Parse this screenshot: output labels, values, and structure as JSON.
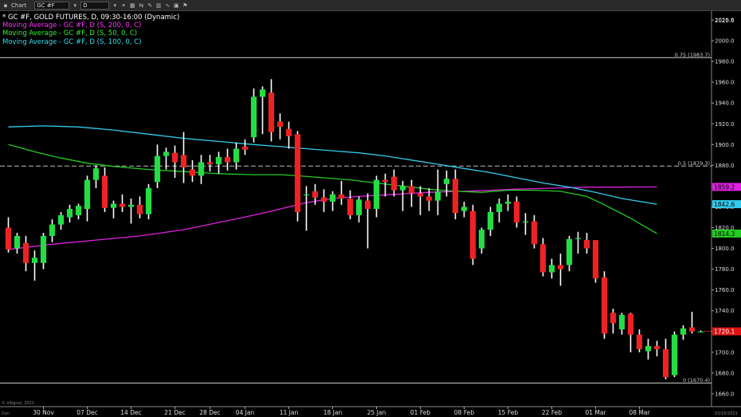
{
  "toolbar": {
    "window_label": "Chart",
    "symbol": "GC #F",
    "interval": "D"
  },
  "legend": {
    "main": "* GC #F, GOLD FUTURES, D, 09:30-16:00 (Dynamic)",
    "ma200": "Moving Average - GC #F, D (S, 200, 0, C)",
    "ma50": "Moving Average - GC #F, D (S, 50, 0, C)",
    "ma100": "Moving Average - GC #F, D (S, 100, 0, C)"
  },
  "colors": {
    "up": "#22dd44",
    "down": "#ee2222",
    "ma200": "#e020e0",
    "ma50": "#22cc22",
    "ma100": "#33ccee",
    "text_main": "#ffffff",
    "text_ma200": "#ff33ff",
    "text_ma50": "#33ee33",
    "text_ma100": "#33ddee"
  },
  "footer": {
    "copyright": "© eSignal, 2021",
    "dyn": "Dyn",
    "date": "03/16/2021"
  },
  "chart_data": {
    "type": "candlestick",
    "title": "* GC #F, GOLD FUTURES, D, 09:30-16:00 (Dynamic)",
    "y_axis_ticks": [
      1660,
      1680,
      1700,
      1720,
      1740,
      1760,
      1780,
      1800,
      1820,
      1840,
      1860,
      1880,
      1900,
      1920,
      1940,
      1960,
      1980,
      2000,
      2020
    ],
    "y_top_label": "2025.6",
    "ylim": [
      1656,
      2025.6
    ],
    "x_axis_labels": [
      {
        "index": 4,
        "label": "30 Nov"
      },
      {
        "index": 9,
        "label": "07 Dec"
      },
      {
        "index": 14,
        "label": "14 Dec"
      },
      {
        "index": 19,
        "label": "21 Dec"
      },
      {
        "index": 23,
        "label": "28 Dec"
      },
      {
        "index": 27,
        "label": "04 Jan"
      },
      {
        "index": 32,
        "label": "11 Jan"
      },
      {
        "index": 37,
        "label": "18 Jan"
      },
      {
        "index": 42,
        "label": "25 Jan"
      },
      {
        "index": 47,
        "label": "01 Feb"
      },
      {
        "index": 52,
        "label": "08 Feb"
      },
      {
        "index": 57,
        "label": "15 Feb"
      },
      {
        "index": 62,
        "label": "22 Feb"
      },
      {
        "index": 67,
        "label": "01 Mar"
      },
      {
        "index": 72,
        "label": "08 Mar"
      }
    ],
    "fib_levels": [
      {
        "ratio_label": "0.75 (1983.7)",
        "value": 1983.7
      },
      {
        "ratio_label": "0.5 (1879.3)",
        "value": 1879.3
      },
      {
        "ratio_label": "0 (1670.4)",
        "value": 1670.4
      }
    ],
    "ma_badges": [
      {
        "label": "1859.2",
        "value": 1859.2,
        "series": "ma200"
      },
      {
        "label": "1842.6",
        "value": 1842.6,
        "series": "ma100"
      },
      {
        "label": "1814.3",
        "value": 1814.3,
        "series": "ma50"
      }
    ],
    "last_price": {
      "label": "1720.1",
      "value": 1720.1
    },
    "candles": [
      {
        "o": 1820,
        "h": 1830,
        "l": 1796,
        "c": 1799
      },
      {
        "o": 1800,
        "h": 1815,
        "l": 1795,
        "c": 1812
      },
      {
        "o": 1805,
        "h": 1812,
        "l": 1778,
        "c": 1786
      },
      {
        "o": 1786,
        "h": 1798,
        "l": 1769,
        "c": 1791
      },
      {
        "o": 1786,
        "h": 1815,
        "l": 1780,
        "c": 1812
      },
      {
        "o": 1812,
        "h": 1828,
        "l": 1806,
        "c": 1823
      },
      {
        "o": 1823,
        "h": 1835,
        "l": 1818,
        "c": 1832
      },
      {
        "o": 1830,
        "h": 1842,
        "l": 1825,
        "c": 1838
      },
      {
        "o": 1832,
        "h": 1843,
        "l": 1828,
        "c": 1841
      },
      {
        "o": 1838,
        "h": 1870,
        "l": 1826,
        "c": 1866
      },
      {
        "o": 1866,
        "h": 1880,
        "l": 1858,
        "c": 1877
      },
      {
        "o": 1870,
        "h": 1878,
        "l": 1835,
        "c": 1839
      },
      {
        "o": 1839,
        "h": 1846,
        "l": 1829,
        "c": 1843
      },
      {
        "o": 1843,
        "h": 1852,
        "l": 1835,
        "c": 1840
      },
      {
        "o": 1840,
        "h": 1848,
        "l": 1824,
        "c": 1842
      },
      {
        "o": 1842,
        "h": 1850,
        "l": 1829,
        "c": 1833
      },
      {
        "o": 1833,
        "h": 1862,
        "l": 1828,
        "c": 1858
      },
      {
        "o": 1864,
        "h": 1900,
        "l": 1858,
        "c": 1889
      },
      {
        "o": 1889,
        "h": 1897,
        "l": 1876,
        "c": 1893
      },
      {
        "o": 1892,
        "h": 1899,
        "l": 1868,
        "c": 1883
      },
      {
        "o": 1890,
        "h": 1912,
        "l": 1863,
        "c": 1878
      },
      {
        "o": 1876,
        "h": 1885,
        "l": 1864,
        "c": 1870
      },
      {
        "o": 1870,
        "h": 1890,
        "l": 1862,
        "c": 1883
      },
      {
        "o": 1883,
        "h": 1890,
        "l": 1874,
        "c": 1881
      },
      {
        "o": 1881,
        "h": 1893,
        "l": 1872,
        "c": 1888
      },
      {
        "o": 1888,
        "h": 1896,
        "l": 1875,
        "c": 1883
      },
      {
        "o": 1883,
        "h": 1902,
        "l": 1876,
        "c": 1896
      },
      {
        "o": 1898,
        "h": 1905,
        "l": 1890,
        "c": 1895
      },
      {
        "o": 1907,
        "h": 1954,
        "l": 1902,
        "c": 1946
      },
      {
        "o": 1946,
        "h": 1956,
        "l": 1910,
        "c": 1953
      },
      {
        "o": 1950,
        "h": 1963,
        "l": 1903,
        "c": 1912
      },
      {
        "o": 1922,
        "h": 1930,
        "l": 1905,
        "c": 1917
      },
      {
        "o": 1915,
        "h": 1922,
        "l": 1896,
        "c": 1908
      },
      {
        "o": 1910,
        "h": 1913,
        "l": 1826,
        "c": 1835
      },
      {
        "o": 1852,
        "h": 1860,
        "l": 1817,
        "c": 1852
      },
      {
        "o": 1855,
        "h": 1862,
        "l": 1842,
        "c": 1849
      },
      {
        "o": 1849,
        "h": 1857,
        "l": 1835,
        "c": 1845
      },
      {
        "o": 1845,
        "h": 1855,
        "l": 1836,
        "c": 1852
      },
      {
        "o": 1852,
        "h": 1865,
        "l": 1842,
        "c": 1848
      },
      {
        "o": 1848,
        "h": 1856,
        "l": 1828,
        "c": 1832
      },
      {
        "o": 1832,
        "h": 1850,
        "l": 1825,
        "c": 1847
      },
      {
        "o": 1846,
        "h": 1853,
        "l": 1800,
        "c": 1838
      },
      {
        "o": 1838,
        "h": 1870,
        "l": 1830,
        "c": 1866
      },
      {
        "o": 1866,
        "h": 1872,
        "l": 1850,
        "c": 1864
      },
      {
        "o": 1869,
        "h": 1876,
        "l": 1850,
        "c": 1856
      },
      {
        "o": 1856,
        "h": 1865,
        "l": 1836,
        "c": 1860
      },
      {
        "o": 1860,
        "h": 1866,
        "l": 1840,
        "c": 1853
      },
      {
        "o": 1853,
        "h": 1860,
        "l": 1832,
        "c": 1850
      },
      {
        "o": 1850,
        "h": 1858,
        "l": 1836,
        "c": 1846
      },
      {
        "o": 1846,
        "h": 1876,
        "l": 1832,
        "c": 1855
      },
      {
        "o": 1862,
        "h": 1875,
        "l": 1850,
        "c": 1867
      },
      {
        "o": 1867,
        "h": 1876,
        "l": 1828,
        "c": 1834
      },
      {
        "o": 1836,
        "h": 1845,
        "l": 1830,
        "c": 1840
      },
      {
        "o": 1836,
        "h": 1842,
        "l": 1784,
        "c": 1790
      },
      {
        "o": 1800,
        "h": 1820,
        "l": 1795,
        "c": 1818
      },
      {
        "o": 1818,
        "h": 1840,
        "l": 1812,
        "c": 1835
      },
      {
        "o": 1835,
        "h": 1848,
        "l": 1825,
        "c": 1843
      },
      {
        "o": 1843,
        "h": 1852,
        "l": 1836,
        "c": 1845
      },
      {
        "o": 1845,
        "h": 1850,
        "l": 1820,
        "c": 1825
      },
      {
        "o": 1825,
        "h": 1834,
        "l": 1813,
        "c": 1826
      },
      {
        "o": 1826,
        "h": 1832,
        "l": 1800,
        "c": 1804
      },
      {
        "o": 1804,
        "h": 1810,
        "l": 1773,
        "c": 1777
      },
      {
        "o": 1777,
        "h": 1790,
        "l": 1771,
        "c": 1784
      },
      {
        "o": 1784,
        "h": 1795,
        "l": 1764,
        "c": 1780
      },
      {
        "o": 1784,
        "h": 1812,
        "l": 1778,
        "c": 1809
      },
      {
        "o": 1809,
        "h": 1816,
        "l": 1795,
        "c": 1810
      },
      {
        "o": 1808,
        "h": 1815,
        "l": 1795,
        "c": 1800
      },
      {
        "o": 1808,
        "h": 1808,
        "l": 1767,
        "c": 1771
      },
      {
        "o": 1772,
        "h": 1778,
        "l": 1713,
        "c": 1718
      },
      {
        "o": 1738,
        "h": 1742,
        "l": 1718,
        "c": 1728
      },
      {
        "o": 1722,
        "h": 1738,
        "l": 1717,
        "c": 1736
      },
      {
        "o": 1737,
        "h": 1738,
        "l": 1700,
        "c": 1717
      },
      {
        "o": 1717,
        "h": 1722,
        "l": 1700,
        "c": 1703
      },
      {
        "o": 1701,
        "h": 1713,
        "l": 1693,
        "c": 1706
      },
      {
        "o": 1706,
        "h": 1711,
        "l": 1696,
        "c": 1703
      },
      {
        "o": 1703,
        "h": 1713,
        "l": 1674,
        "c": 1676
      },
      {
        "o": 1678,
        "h": 1720,
        "l": 1676,
        "c": 1717
      },
      {
        "o": 1717,
        "h": 1726,
        "l": 1712,
        "c": 1723
      },
      {
        "o": 1724,
        "h": 1739,
        "l": 1718,
        "c": 1720
      },
      {
        "o": 1720,
        "h": 1721,
        "l": 1719,
        "c": 1720
      }
    ],
    "series": [
      {
        "name": "Moving Average - GC #F, D (S, 200, 0, C)",
        "key": "ma200",
        "points": [
          [
            0,
            1799
          ],
          [
            5,
            1804
          ],
          [
            10,
            1808
          ],
          [
            15,
            1812
          ],
          [
            20,
            1818
          ],
          [
            24,
            1825
          ],
          [
            28,
            1832
          ],
          [
            31,
            1838
          ],
          [
            34,
            1844
          ],
          [
            37,
            1848
          ],
          [
            40,
            1850
          ],
          [
            44,
            1852
          ],
          [
            48,
            1854
          ],
          [
            52,
            1855
          ],
          [
            55,
            1856
          ],
          [
            58,
            1857
          ],
          [
            62,
            1858
          ],
          [
            66,
            1859
          ],
          [
            70,
            1859
          ],
          [
            74,
            1859.2
          ]
        ]
      },
      {
        "name": "Moving Average - GC #F, D (S, 50, 0, C)",
        "key": "ma50",
        "points": [
          [
            0,
            1900
          ],
          [
            3,
            1893
          ],
          [
            6,
            1887
          ],
          [
            9,
            1882
          ],
          [
            12,
            1879
          ],
          [
            16,
            1876
          ],
          [
            20,
            1874
          ],
          [
            24,
            1872
          ],
          [
            28,
            1871
          ],
          [
            31,
            1871
          ],
          [
            33,
            1870
          ],
          [
            36,
            1868
          ],
          [
            39,
            1866
          ],
          [
            42,
            1863
          ],
          [
            45,
            1860
          ],
          [
            48,
            1857
          ],
          [
            51,
            1855
          ],
          [
            54,
            1854
          ],
          [
            57,
            1856
          ],
          [
            60,
            1856
          ],
          [
            63,
            1855
          ],
          [
            66,
            1850
          ],
          [
            68,
            1842
          ],
          [
            71,
            1829
          ],
          [
            74,
            1814.3
          ]
        ]
      },
      {
        "name": "Moving Average - GC #F, D (S, 100, 0, C)",
        "key": "ma100",
        "points": [
          [
            0,
            1917
          ],
          [
            4,
            1918
          ],
          [
            8,
            1917
          ],
          [
            12,
            1914
          ],
          [
            16,
            1910
          ],
          [
            20,
            1906
          ],
          [
            24,
            1903
          ],
          [
            28,
            1900
          ],
          [
            31,
            1898
          ],
          [
            34,
            1896
          ],
          [
            37,
            1894
          ],
          [
            40,
            1892
          ],
          [
            43,
            1889
          ],
          [
            46,
            1885
          ],
          [
            49,
            1881
          ],
          [
            52,
            1877
          ],
          [
            55,
            1873
          ],
          [
            58,
            1868
          ],
          [
            61,
            1863
          ],
          [
            64,
            1859
          ],
          [
            67,
            1854
          ],
          [
            70,
            1848
          ],
          [
            74,
            1842.6
          ]
        ]
      }
    ]
  }
}
